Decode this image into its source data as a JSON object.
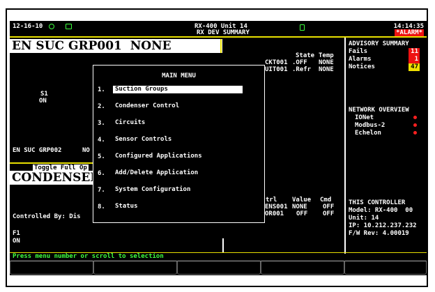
{
  "header": {
    "date": "12-16-10",
    "unit_line": "RX-400 Unit 14",
    "screen_title": "RX DEV SUMMARY",
    "time": "14:14:35",
    "alarm_label": "*ALARM*"
  },
  "left_panel": {
    "group_title": "EN SUC GRP001",
    "group_state": "NONE",
    "s1_label": "S1",
    "s1_state": "ON",
    "group2_label": "EN SUC GRP002",
    "group2_trunc": "NO",
    "toggle_label": "Toggle Full Op",
    "condenser_title": "CONDENSERC",
    "controlled_by": "Controlled By: Dis",
    "f1_label": "F1",
    "f1_state": "ON"
  },
  "circuits": {
    "header_state": "State",
    "header_temp": "Temp",
    "rows": [
      {
        "name": "CKT001",
        "state": ".OFF",
        "temp": "NONE"
      },
      {
        "name": "UIT001",
        "state": ".Refr",
        "temp": "NONE"
      }
    ]
  },
  "condenser_table": {
    "headers": [
      "trl",
      "Value",
      "Cmd"
    ],
    "rows": [
      {
        "name": "ENS001",
        "value": "NONE",
        "cmd": "OFF"
      },
      {
        "name": "OR001",
        "value": "OFF",
        "cmd": "OFF"
      }
    ]
  },
  "advisory": {
    "title": "ADVISORY SUMMARY",
    "items": [
      {
        "label": "Fails",
        "count": "11",
        "color": "#ee1111"
      },
      {
        "label": "Alarms",
        "count": "1",
        "color": "#ee1111"
      },
      {
        "label": "Notices",
        "count": "47",
        "color": "#f0e000"
      }
    ]
  },
  "network": {
    "title": "NETWORK OVERVIEW",
    "items": [
      "IONet",
      "Modbus-2",
      "Echelon"
    ],
    "status_color": "#ff2020"
  },
  "controller": {
    "title": "THIS CONTROLLER",
    "model": "Model: RX-400  00",
    "unit": "Unit: 14",
    "ip": "IP: 10.212.237.232",
    "fw": "F/W Rev: 4.00019"
  },
  "menu": {
    "title": "MAIN MENU",
    "items": [
      {
        "num": "1.",
        "label": "Suction Groups"
      },
      {
        "num": "2.",
        "label": "Condenser Control"
      },
      {
        "num": "3.",
        "label": "Circuits"
      },
      {
        "num": "4.",
        "label": "Sensor Controls"
      },
      {
        "num": "5.",
        "label": "Configured Applications"
      },
      {
        "num": "6.",
        "label": "Add/Delete Application"
      },
      {
        "num": "7.",
        "label": "System Configuration"
      },
      {
        "num": "8.",
        "label": "Status"
      }
    ]
  },
  "status_bar": {
    "message": "Press menu number or scroll to selection",
    "color": "#40ff40"
  }
}
